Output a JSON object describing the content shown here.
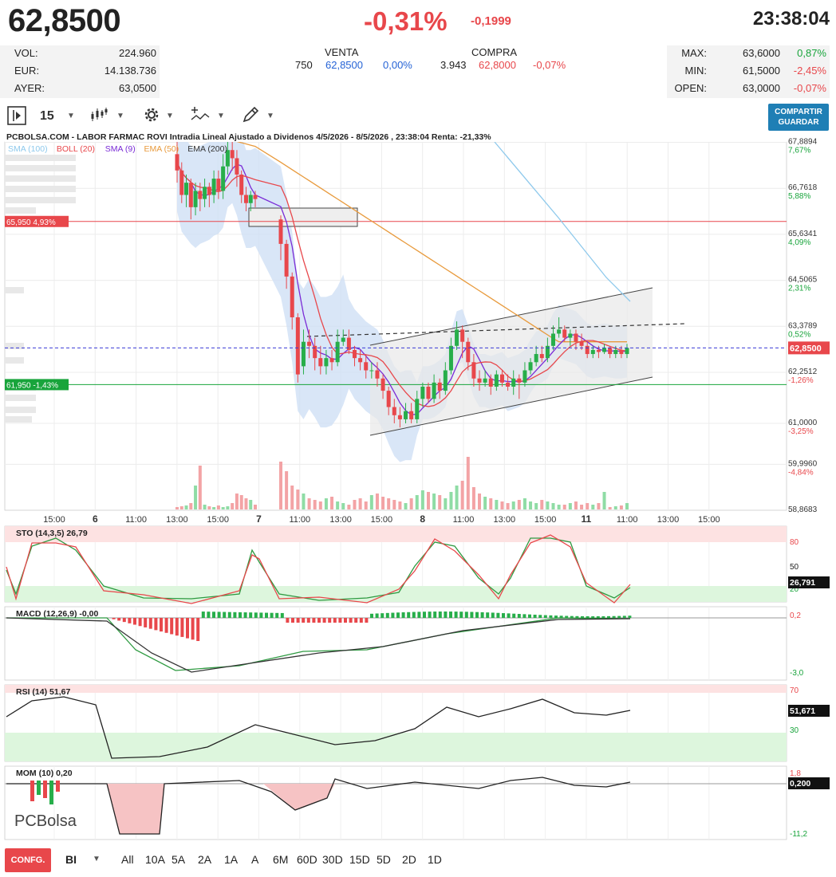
{
  "header": {
    "price": "62,8500",
    "pct": "-0,31%",
    "change": "-0,1999",
    "time": "23:38:04"
  },
  "stats_left": [
    {
      "label": "VOL:",
      "value": "224.960"
    },
    {
      "label": "EUR:",
      "value": "14.138.736"
    },
    {
      "label": "AYER:",
      "value": "63,0500"
    }
  ],
  "quotes": {
    "venta_label": "VENTA",
    "compra_label": "COMPRA",
    "venta_qty": "750",
    "venta_price": "62,8500",
    "venta_pct": "0,00%",
    "compra_qty": "3.943",
    "compra_price": "62,8000",
    "compra_pct": "-0,07%"
  },
  "stats_right": [
    {
      "label": "MAX:",
      "value": "63,6000",
      "pct": "0,87%",
      "pct_color": "#18a43b"
    },
    {
      "label": "MIN:",
      "value": "61,5000",
      "pct": "-2,45%",
      "pct_color": "#e8474b"
    },
    {
      "label": "OPEN:",
      "value": "63,0000",
      "pct": "-0,07%",
      "pct_color": "#e8474b"
    }
  ],
  "toolbar": {
    "interval": "15",
    "share_line1": "COMPARTIR",
    "share_line2": "GUARDAR"
  },
  "bottom": {
    "config": "CONFG.",
    "mode": "BI",
    "ranges": [
      "All",
      "10A",
      "5A",
      "2A",
      "1A",
      "A",
      "6M",
      "60D",
      "30D",
      "15D",
      "5D",
      "2D",
      "1D"
    ]
  },
  "chart_data": {
    "type": "candlestick",
    "title": "PCBOLSA.COM - LABOR FARMAC ROVI Intradia Lineal Ajustado a Dividenos 4/5/2026 - 8/5/2026 , 23:38:04 Renta: -21,33%",
    "legend": [
      {
        "name": "SMA (100)",
        "color": "#8ec9ec"
      },
      {
        "name": "BOLL (20)",
        "color": "#e8474b"
      },
      {
        "name": "SMA (9)",
        "color": "#7a2bd6"
      },
      {
        "name": "EMA (50)",
        "color": "#e89a3c"
      },
      {
        "name": "EMA (200)",
        "color": "#333333"
      }
    ],
    "price_axis": {
      "ticks": [
        {
          "value": 67.8894,
          "label": "67,8894",
          "pct": "7,67%"
        },
        {
          "value": 66.7618,
          "label": "66,7618",
          "pct": "5,88%"
        },
        {
          "value": 65.6341,
          "label": "65,6341",
          "pct": "4,09%"
        },
        {
          "value": 64.5065,
          "label": "64,5065",
          "pct": "2,31%"
        },
        {
          "value": 63.3789,
          "label": "63,3789",
          "pct": "0,52%"
        },
        {
          "value": 62.2512,
          "label": "62,2512",
          "pct": "-1,26%"
        },
        {
          "value": 61.0,
          "label": "61,0000",
          "pct": "-3,25%"
        },
        {
          "value": 59.996,
          "label": "59,9960",
          "pct": "-4,84%"
        },
        {
          "value": 58.8683,
          "label": "58,8683",
          "pct": ""
        }
      ],
      "current": {
        "value": 62.85,
        "label": "62,8500"
      },
      "levels": [
        {
          "value": 65.95,
          "label": "65,950  4,93%",
          "color": "#e8474b"
        },
        {
          "value": 61.95,
          "label": "61,950  -1,43%",
          "color": "#18a43b"
        }
      ],
      "range": [
        58.87,
        67.9
      ]
    },
    "x_labels": [
      {
        "label": "15:00",
        "bold": false
      },
      {
        "label": "6",
        "bold": true
      },
      {
        "label": "11:00",
        "bold": false
      },
      {
        "label": "13:00",
        "bold": false
      },
      {
        "label": "15:00",
        "bold": false
      },
      {
        "label": "7",
        "bold": true
      },
      {
        "label": "11:00",
        "bold": false
      },
      {
        "label": "13:00",
        "bold": false
      },
      {
        "label": "15:00",
        "bold": false
      },
      {
        "label": "8",
        "bold": true
      },
      {
        "label": "11:00",
        "bold": false
      },
      {
        "label": "13:00",
        "bold": false
      },
      {
        "label": "15:00",
        "bold": false
      },
      {
        "label": "11",
        "bold": true
      },
      {
        "label": "11:00",
        "bold": false
      },
      {
        "label": "13:00",
        "bold": false
      },
      {
        "label": "15:00",
        "bold": false
      }
    ],
    "candles": [
      [
        67.6,
        67.2,
        67.9,
        66.9
      ],
      [
        67.2,
        66.6,
        67.4,
        66.4
      ],
      [
        66.6,
        66.9,
        67.1,
        66.3
      ],
      [
        66.9,
        66.3,
        67.0,
        66.0
      ],
      [
        66.3,
        66.7,
        66.9,
        66.1
      ],
      [
        66.7,
        66.5,
        66.9,
        66.2
      ],
      [
        66.5,
        66.8,
        67.0,
        66.3
      ],
      [
        66.8,
        66.6,
        66.9,
        66.3
      ],
      [
        66.6,
        67.0,
        67.2,
        66.4
      ],
      [
        67.0,
        66.7,
        67.2,
        66.5
      ],
      [
        66.7,
        67.3,
        67.6,
        66.5
      ],
      [
        67.3,
        67.7,
        67.9,
        67.1
      ],
      [
        67.7,
        67.5,
        67.9,
        67.2
      ],
      [
        67.5,
        67.1,
        67.7,
        66.8
      ],
      [
        67.1,
        66.6,
        67.2,
        66.4
      ],
      [
        66.6,
        66.4,
        66.8,
        66.2
      ],
      [
        66.4,
        66.6,
        66.7,
        66.2
      ],
      [
        66.6,
        66.5,
        66.7,
        66.3
      ],
      [
        66.0,
        65.4,
        66.1,
        65.0
      ],
      [
        65.4,
        64.6,
        65.5,
        64.3
      ],
      [
        64.6,
        63.6,
        64.7,
        63.3
      ],
      [
        63.6,
        62.2,
        63.7,
        62.0
      ],
      [
        62.4,
        63.0,
        63.3,
        62.2
      ],
      [
        63.0,
        62.9,
        63.3,
        62.6
      ],
      [
        62.9,
        62.6,
        63.1,
        62.3
      ],
      [
        62.6,
        62.4,
        62.9,
        62.2
      ],
      [
        62.4,
        62.6,
        62.8,
        62.2
      ],
      [
        62.6,
        62.5,
        62.8,
        62.3
      ],
      [
        62.5,
        63.0,
        63.3,
        62.4
      ],
      [
        63.0,
        63.1,
        63.3,
        62.9
      ],
      [
        63.1,
        62.8,
        63.3,
        62.7
      ],
      [
        62.8,
        62.6,
        62.9,
        62.4
      ],
      [
        62.6,
        62.5,
        62.8,
        62.3
      ],
      [
        62.5,
        62.3,
        62.7,
        62.1
      ],
      [
        62.3,
        62.3,
        62.5,
        62.1
      ],
      [
        62.3,
        62.1,
        62.5,
        61.9
      ],
      [
        62.1,
        61.8,
        62.2,
        61.6
      ],
      [
        61.8,
        61.4,
        61.9,
        61.2
      ],
      [
        61.4,
        61.2,
        61.6,
        61.0
      ],
      [
        61.2,
        61.1,
        61.4,
        60.9
      ],
      [
        61.1,
        61.3,
        61.5,
        61.0
      ],
      [
        61.3,
        61.1,
        61.5,
        61.0
      ],
      [
        61.1,
        61.6,
        61.8,
        61.0
      ],
      [
        61.6,
        61.9,
        62.0,
        61.4
      ],
      [
        61.9,
        61.6,
        62.0,
        61.5
      ],
      [
        61.6,
        62.0,
        62.2,
        61.5
      ],
      [
        62.0,
        61.8,
        62.1,
        61.6
      ],
      [
        61.8,
        62.3,
        62.5,
        61.7
      ],
      [
        62.3,
        62.9,
        63.1,
        62.2
      ],
      [
        62.9,
        63.3,
        63.5,
        62.8
      ],
      [
        63.3,
        63.0,
        63.4,
        62.6
      ],
      [
        63.0,
        62.5,
        63.1,
        62.3
      ],
      [
        62.5,
        62.1,
        62.7,
        61.9
      ],
      [
        62.1,
        62.0,
        62.3,
        61.8
      ],
      [
        62.0,
        62.1,
        62.3,
        61.9
      ],
      [
        62.1,
        61.9,
        62.2,
        61.7
      ],
      [
        61.9,
        62.2,
        62.3,
        61.8
      ],
      [
        62.2,
        62.0,
        62.3,
        61.9
      ],
      [
        62.0,
        61.9,
        62.2,
        61.8
      ],
      [
        61.9,
        62.1,
        62.3,
        61.7
      ],
      [
        62.1,
        62.0,
        62.2,
        61.6
      ],
      [
        62.0,
        62.3,
        62.5,
        61.9
      ],
      [
        62.3,
        62.5,
        62.6,
        62.2
      ],
      [
        62.5,
        62.7,
        62.9,
        62.4
      ],
      [
        62.7,
        62.6,
        62.9,
        62.5
      ],
      [
        62.6,
        62.9,
        63.1,
        62.5
      ],
      [
        62.9,
        63.2,
        63.4,
        62.8
      ],
      [
        63.2,
        63.3,
        63.6,
        63.1
      ],
      [
        63.3,
        63.1,
        63.4,
        63.0
      ],
      [
        63.1,
        63.2,
        63.3,
        62.9
      ],
      [
        63.2,
        63.0,
        63.3,
        62.8
      ],
      [
        63.0,
        62.9,
        63.2,
        62.8
      ],
      [
        62.9,
        62.7,
        63.0,
        62.6
      ],
      [
        62.7,
        62.8,
        62.9,
        62.6
      ],
      [
        62.8,
        62.75,
        62.9,
        62.6
      ],
      [
        62.75,
        62.85,
        62.95,
        62.7
      ],
      [
        62.85,
        62.7,
        62.9,
        62.6
      ],
      [
        62.7,
        62.8,
        62.9,
        62.6
      ],
      [
        62.8,
        62.7,
        62.9,
        62.6
      ],
      [
        62.7,
        62.85,
        62.95,
        62.6
      ]
    ],
    "volume_label_max": "",
    "indicators": {
      "sto": {
        "label": "STO (14,3,5)",
        "value": "26,79",
        "current": "26,791",
        "levels": [
          "80",
          "50",
          "20"
        ]
      },
      "macd": {
        "label": "MACD (12,26,9)",
        "value": "-0,00",
        "levels": [
          "0,2",
          "-3,0"
        ]
      },
      "rsi": {
        "label": "RSI (14)",
        "value": "51,67",
        "current": "51,671",
        "levels": [
          "70",
          "30"
        ]
      },
      "mom": {
        "label": "MOM (10)",
        "value": "0,20",
        "current": "0,200",
        "levels": [
          "1,8",
          "-11,2"
        ]
      }
    },
    "logo_text": "PCBolsa"
  }
}
